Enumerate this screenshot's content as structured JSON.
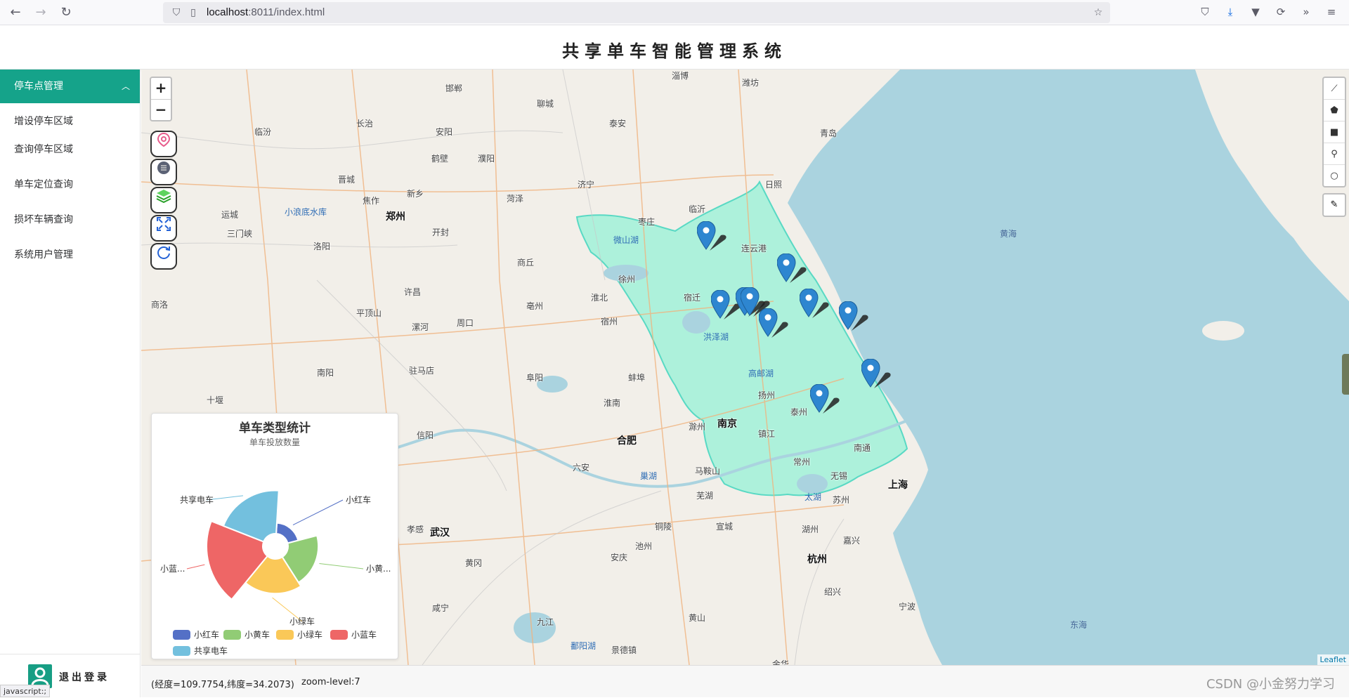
{
  "browser": {
    "url_host": "localhost",
    "url_rest": ":8011/index.html"
  },
  "header": {
    "title": "共享单车智能管理系统"
  },
  "sidebar": {
    "group_label": "停车点管理",
    "items": [
      {
        "label": "增设停车区域"
      },
      {
        "label": "查询停车区域"
      },
      {
        "label": "单车定位查询"
      },
      {
        "label": "损坏车辆查询"
      },
      {
        "label": "系统用户管理"
      }
    ],
    "logout_label": "退出登录",
    "status_text": "javascript:;"
  },
  "map": {
    "zoom_in": "+",
    "zoom_out": "−",
    "attribution": "Leaflet",
    "cities": [
      {
        "name": "郑州",
        "big": true
      },
      {
        "name": "南京",
        "big": true
      },
      {
        "name": "合肥",
        "big": true
      },
      {
        "name": "上海",
        "big": true
      },
      {
        "name": "杭州",
        "big": true
      },
      {
        "name": "武汉",
        "big": true
      },
      {
        "name": "邯郸"
      },
      {
        "name": "聊城"
      },
      {
        "name": "淄博"
      },
      {
        "name": "潍坊"
      },
      {
        "name": "临汾"
      },
      {
        "name": "长治"
      },
      {
        "name": "安阳"
      },
      {
        "name": "泰安"
      },
      {
        "name": "青岛"
      },
      {
        "name": "鹤壁"
      },
      {
        "name": "濮阳"
      },
      {
        "name": "晋城"
      },
      {
        "name": "济宁"
      },
      {
        "name": "临沂"
      },
      {
        "name": "日照"
      },
      {
        "name": "焦作"
      },
      {
        "name": "新乡"
      },
      {
        "name": "菏泽"
      },
      {
        "name": "运城"
      },
      {
        "name": "三门峡"
      },
      {
        "name": "开封"
      },
      {
        "name": "洛阳"
      },
      {
        "name": "枣庄"
      },
      {
        "name": "连云港"
      },
      {
        "name": "商丘"
      },
      {
        "name": "徐州"
      },
      {
        "name": "宿迁"
      },
      {
        "name": "淮北"
      },
      {
        "name": "许昌"
      },
      {
        "name": "商洛"
      },
      {
        "name": "平顶山"
      },
      {
        "name": "漯河"
      },
      {
        "name": "周口"
      },
      {
        "name": "亳州"
      },
      {
        "name": "宿州"
      },
      {
        "name": "高邮湖"
      },
      {
        "name": "扬州"
      },
      {
        "name": "泰州"
      },
      {
        "name": "镇江"
      },
      {
        "name": "南阳"
      },
      {
        "name": "驻马店"
      },
      {
        "name": "阜阳"
      },
      {
        "name": "蚌埠"
      },
      {
        "name": "淮南"
      },
      {
        "name": "十堰"
      },
      {
        "name": "信阳"
      },
      {
        "name": "滁州"
      },
      {
        "name": "南通"
      },
      {
        "name": "六安"
      },
      {
        "name": "马鞍山"
      },
      {
        "name": "常州"
      },
      {
        "name": "无锡"
      },
      {
        "name": "太湖"
      },
      {
        "name": "苏州"
      },
      {
        "name": "芜湖"
      },
      {
        "name": "孝感"
      },
      {
        "name": "铜陵"
      },
      {
        "name": "宣城"
      },
      {
        "name": "湖州"
      },
      {
        "name": "嘉兴"
      },
      {
        "name": "池州"
      },
      {
        "name": "安庆"
      },
      {
        "name": "黄冈"
      },
      {
        "name": "绍兴"
      },
      {
        "name": "宁波"
      },
      {
        "name": "咸宁"
      },
      {
        "name": "九江"
      },
      {
        "name": "黄山"
      },
      {
        "name": "景德镇"
      },
      {
        "name": "鄱阳湖"
      },
      {
        "name": "金华"
      },
      {
        "name": "黄海",
        "sea": true
      },
      {
        "name": "东海",
        "sea": true
      },
      {
        "name": "小浪底水库",
        "water": true
      },
      {
        "name": "微山湖",
        "water": true
      },
      {
        "name": "巢湖",
        "water": true
      },
      {
        "name": "洪泽湖",
        "water": true
      }
    ]
  },
  "chart_data": {
    "type": "pie",
    "variant": "nightingale-rose",
    "title": "单车类型统计",
    "subtitle": "单车投放数量",
    "categories": [
      "小红车",
      "小黄车",
      "小绿车",
      "小蓝车",
      "共享电车"
    ],
    "values": [
      10,
      28,
      32,
      52,
      40
    ],
    "colors": [
      "#5470c6",
      "#91cc75",
      "#fac858",
      "#ee6666",
      "#73c0de"
    ],
    "slice_labels": [
      "小红车",
      "小黄...",
      "小绿车",
      "小蓝...",
      "共享电车"
    ],
    "legend": [
      "小红车",
      "小黄车",
      "小绿车",
      "小蓝车",
      "共享电车"
    ]
  },
  "footer": {
    "coords": "(经度=109.7754,纬度=34.2073)",
    "zoom": "zoom-level:7",
    "watermark": "CSDN @小金努力学习"
  }
}
